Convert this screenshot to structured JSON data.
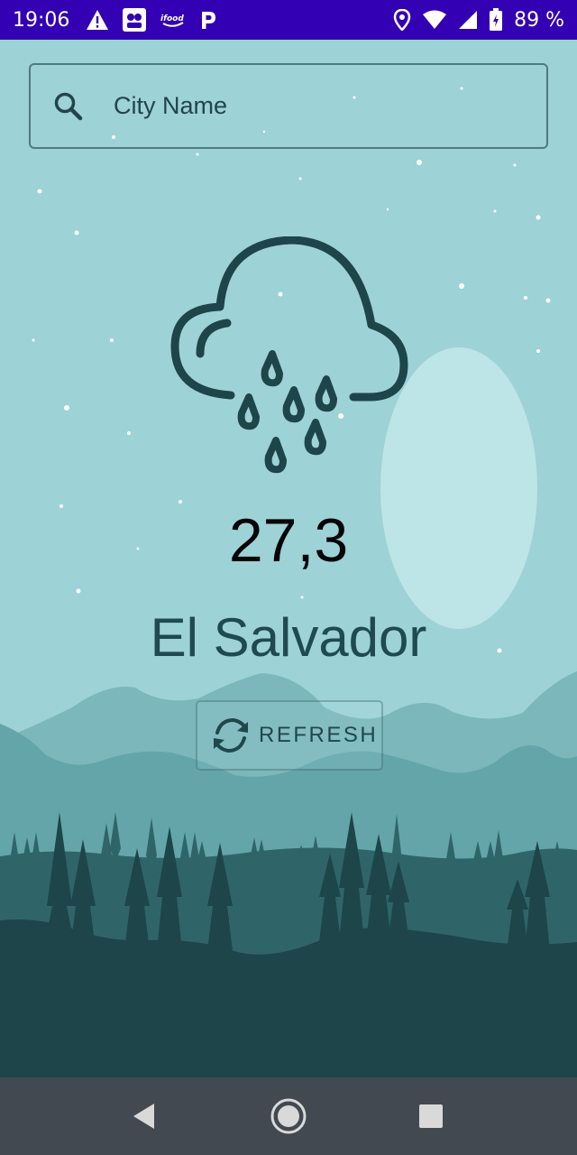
{
  "status_bar": {
    "time": "19:06",
    "battery_percent": "89 %",
    "icons": [
      "alert-icon",
      "app-notification-icon",
      "ifood-icon",
      "p-app-icon",
      "location-icon",
      "wifi-icon",
      "signal-icon",
      "battery-icon"
    ],
    "ifood_label": "ifood"
  },
  "search": {
    "placeholder": "City Name",
    "value": ""
  },
  "weather": {
    "condition_icon": "cloud-rain-icon",
    "temperature": "27,3",
    "city": "El Salvador"
  },
  "refresh": {
    "label": "REFRESH",
    "icon": "refresh-icon"
  },
  "nav": {
    "buttons": [
      "back-icon",
      "home-icon",
      "recents-icon"
    ]
  },
  "colors": {
    "status_bar": "#3300b3",
    "sky": "#9dd2d6",
    "moon": "#bde4e6",
    "far_hills": "#7bb7bb",
    "mid_hills": "#64a5aa",
    "trees_far": "#2f6569",
    "ground": "#1d454a",
    "nav_bar": "#434950"
  }
}
